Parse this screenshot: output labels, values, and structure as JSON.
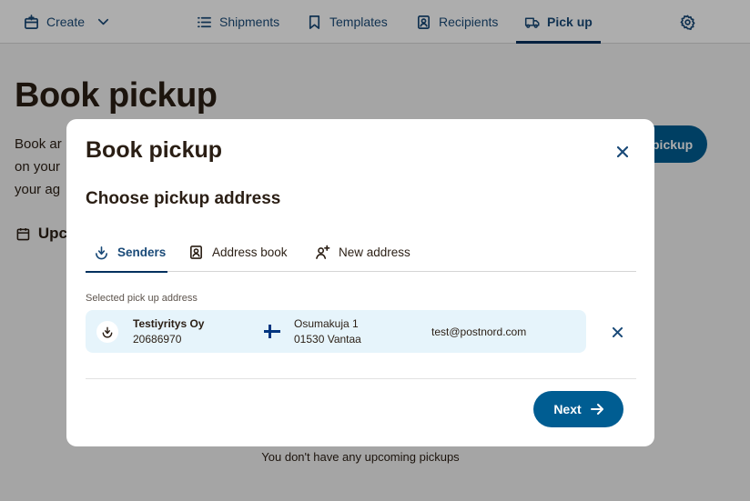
{
  "nav": {
    "create_label": "Create",
    "items": [
      {
        "label": "Shipments",
        "icon": "list-icon"
      },
      {
        "label": "Templates",
        "icon": "bookmark-icon"
      },
      {
        "label": "Recipients",
        "icon": "contact-icon"
      },
      {
        "label": "Pick up",
        "icon": "truck-icon",
        "active": true
      }
    ],
    "settings_icon": "gear-icon"
  },
  "page": {
    "title": "Book pickup",
    "description_lines": [
      "Book ar",
      "on your",
      "your ag"
    ],
    "book_button_label": "pickup",
    "upcoming_heading": "Upc",
    "empty_text": "You don't have any upcoming pickups"
  },
  "modal": {
    "title": "Book pickup",
    "subtitle": "Choose pickup address",
    "tabs": [
      {
        "label": "Senders",
        "icon": "senders-icon",
        "active": true
      },
      {
        "label": "Address book",
        "icon": "address-book-icon"
      },
      {
        "label": "New address",
        "icon": "new-address-icon"
      }
    ],
    "selected_label": "Selected pick up address",
    "address": {
      "company": "Testiyritys Oy",
      "id": "20686970",
      "street": "Osumakuja 1",
      "city": "01530 Vantaa",
      "email": "test@postnord.com",
      "country_flag": "finland-flag"
    },
    "next_label": "Next"
  },
  "colors": {
    "primary": "#005d92",
    "nav_text": "#1a4a78",
    "card_bg": "#e6f4fb",
    "text": "#2a1e14"
  }
}
